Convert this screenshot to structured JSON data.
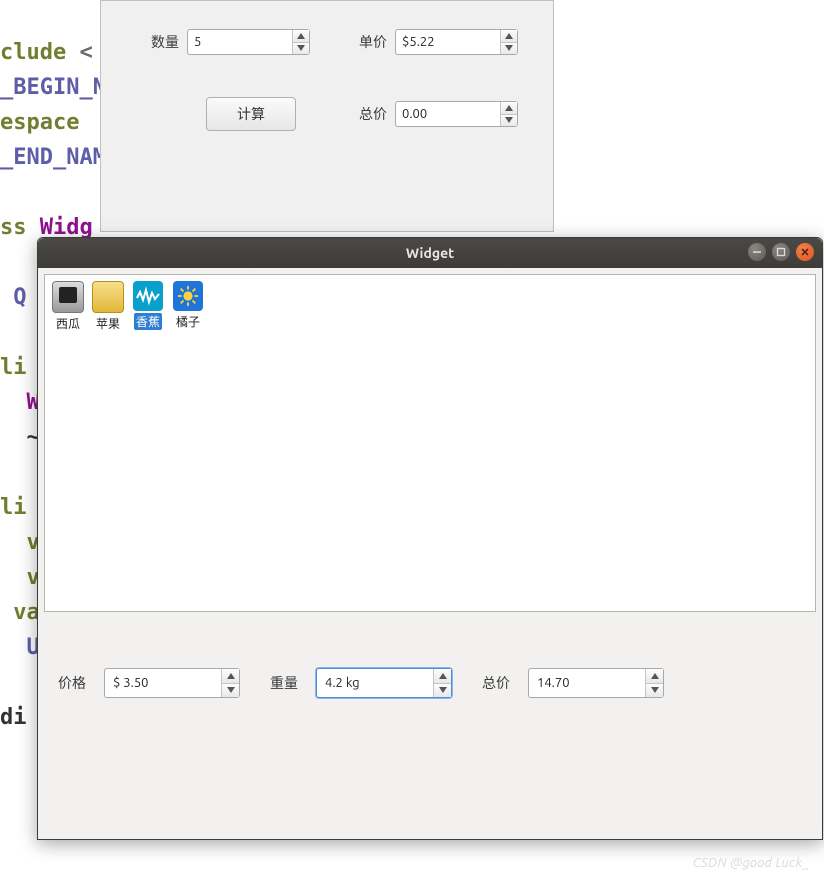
{
  "code_bg": {
    "l0a": "clude ",
    "l0b": "<",
    "l1": "_BEGIN_N",
    "l2": "espace ",
    "l3": "_END_NAM",
    "l4a": "ss ",
    "l4b": "Widg",
    "l5": "Q",
    "l6": "li",
    "l7": "W",
    "l8": "~",
    "l9": "li",
    "l10": "v",
    "l11": "v",
    "l12": "va",
    "l13": "U",
    "l14": "di"
  },
  "dialog1": {
    "qty_label": "数量",
    "qty_value": "5",
    "price_label": "单价",
    "price_value": "$5.22",
    "calc_label": "计算",
    "total_label": "总价",
    "total_value": "0.00"
  },
  "widget": {
    "title": "Widget",
    "items": [
      {
        "label": "西瓜",
        "icon": "phone"
      },
      {
        "label": "苹果",
        "icon": "note"
      },
      {
        "label": "香蕉",
        "icon": "wave",
        "selected": true
      },
      {
        "label": "橘子",
        "icon": "sun"
      }
    ],
    "price_label": "价格",
    "price_value": "$ 3.50",
    "weight_label": "重量",
    "weight_value": "4.2 kg",
    "total_label": "总价",
    "total_value": "14.70"
  },
  "watermark": "CSDN @good Luck_"
}
